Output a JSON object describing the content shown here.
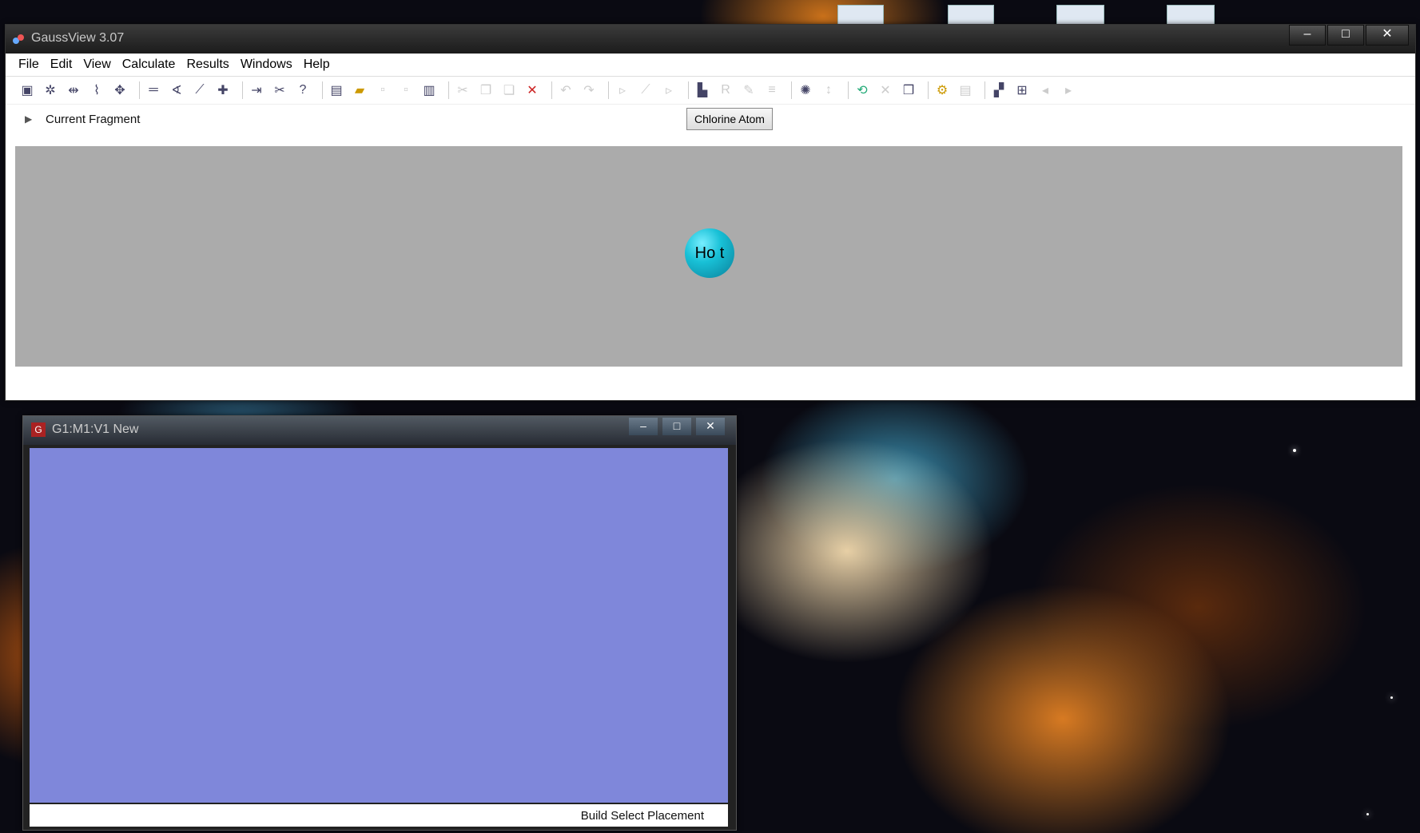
{
  "main_window": {
    "title": "GaussView 3.07",
    "menu": [
      "File",
      "Edit",
      "View",
      "Calculate",
      "Results",
      "Windows",
      "Help"
    ],
    "current_fragment_label": "Current Fragment",
    "fragment_button": "Chlorine Atom",
    "atom_label": "Ho t",
    "controls": {
      "minimize": "–",
      "maximize": "□",
      "close": "✕"
    }
  },
  "child_window": {
    "title": "G1:M1:V1 New",
    "status": "Build  Select Placement",
    "controls": {
      "minimize": "–",
      "maximize": "□",
      "close": "✕"
    }
  },
  "colors": {
    "fragment_panel": "#ababab",
    "atom": "#18c0d6",
    "canvas": "#7f87da"
  },
  "toolbar_icons": [
    "select-icon",
    "rotate-icon",
    "bond-icon",
    "bond-length-icon",
    "atom-icon",
    "ring-icon",
    "angle-icon",
    "dihedral-icon",
    "add-valence-icon",
    "symmetry-icon",
    "delete-icon",
    "help-icon",
    "open-icon",
    "folder-icon",
    "save-icon",
    "print-icon",
    "clipboard-icon",
    "cut-icon",
    "copy-icon",
    "paste-icon",
    "cancel-icon",
    "undo-icon",
    "redo-icon",
    "inquire-icon",
    "measure-icon",
    "tags-icon",
    "document-icon",
    "reset-icon",
    "pencil-icon",
    "builder-icon",
    "sync-icon",
    "pointer-icon",
    "refresh-icon",
    "clean-icon",
    "window-icon",
    "gear-icon",
    "bookmark-icon",
    "tile-icon",
    "grid-icon",
    "prev-icon",
    "next-icon"
  ]
}
